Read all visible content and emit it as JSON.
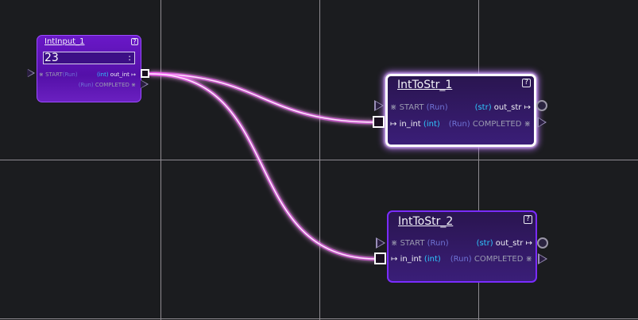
{
  "colors": {
    "background": "#1b1c1f",
    "grid": "#8f8b91",
    "node_fill": "#3a1a78",
    "node_border_selected": "#ffffff",
    "node_border": "#8a3cff",
    "wire": "#ff66ff",
    "type_cyan": "#2ec8ff"
  },
  "nodes": {
    "int_input": {
      "title": "IntInput_1",
      "help": "?",
      "value": "23",
      "spinner": ":",
      "start_glyph": "⋇",
      "start_label": "START",
      "start_type": "(Run)",
      "out_type": "(int)",
      "out_label": "out_int",
      "out_glyph": "↦",
      "completed_type": "(Run)",
      "completed_label": "COMPLETED",
      "completed_glyph": "⋇"
    },
    "int_to_str_1": {
      "title": "IntToStr_1",
      "help": "?",
      "start_glyph": "⋇",
      "start_label": "START",
      "start_type": "(Run)",
      "out_type": "(str)",
      "out_label": "out_str",
      "out_glyph": "↦",
      "in_glyph": "↦",
      "in_label": "in_int",
      "in_type": "(int)",
      "completed_type": "(Run)",
      "completed_label": "COMPLETED",
      "completed_glyph": "⋇"
    },
    "int_to_str_2": {
      "title": "IntToStr_2",
      "help": "?",
      "start_glyph": "⋇",
      "start_label": "START",
      "start_type": "(Run)",
      "out_type": "(str)",
      "out_label": "out_str",
      "out_glyph": "↦",
      "in_glyph": "↦",
      "in_label": "in_int",
      "in_type": "(int)",
      "completed_type": "(Run)",
      "completed_label": "COMPLETED",
      "completed_glyph": "⋇"
    }
  }
}
